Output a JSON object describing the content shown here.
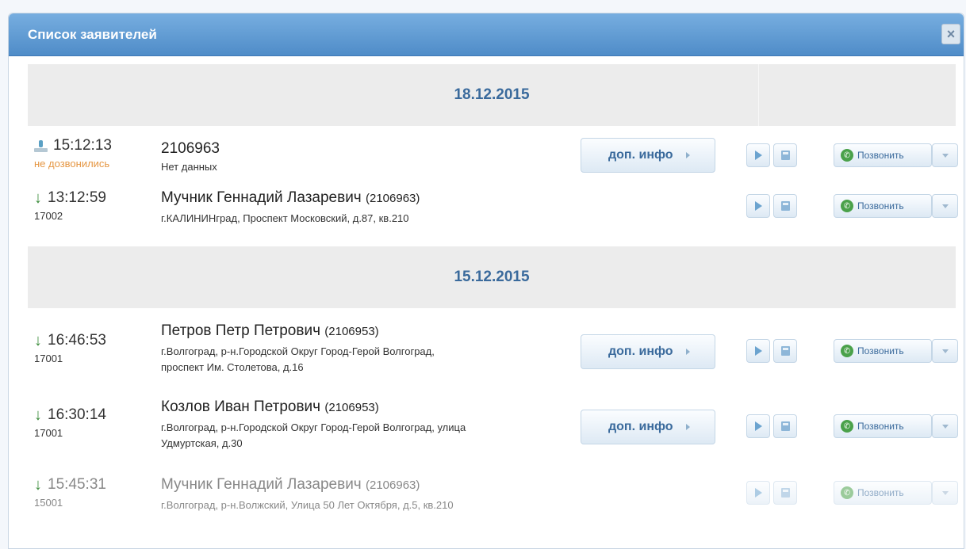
{
  "dialog": {
    "title": "Список заявителей",
    "close_icon": "close-icon"
  },
  "groups": [
    {
      "date": "18.12.2015",
      "rows": [
        {
          "time": "15:12:13",
          "sub": "не дозвонились",
          "icon": "phone-handset-icon",
          "name": "2106963",
          "code": "",
          "addr": [
            "Нет данных"
          ],
          "has_info": true
        },
        {
          "time": "13:12:59",
          "sub": "17002",
          "icon": "arrow-down-icon",
          "name": "Мучник Геннадий Лазаревич",
          "code": "(2106963)",
          "addr": [
            "г.КАЛИНИНград, Проспект Московский, д.87, кв.210"
          ],
          "has_info": false
        }
      ]
    },
    {
      "date": "15.12.2015",
      "rows": [
        {
          "time": "16:46:53",
          "sub": "17001",
          "icon": "arrow-down-icon",
          "name": "Петров Петр Петрович",
          "code": "(2106953)",
          "addr": [
            "г.Волгоград, р-н.Городской Округ Город-Герой Волгоград,",
            "проспект Им. Столетова, д.16"
          ],
          "has_info": true
        },
        {
          "time": "16:30:14",
          "sub": "17001",
          "icon": "arrow-down-icon",
          "name": "Козлов Иван Петрович",
          "code": "(2106953)",
          "addr": [
            "г.Волгоград, р-н.Городской Округ Город-Герой Волгоград, улица",
            "Удмуртская, д.30"
          ],
          "has_info": true
        },
        {
          "time": "15:45:31",
          "sub": "15001",
          "icon": "arrow-down-icon",
          "name": "Мучник Геннадий Лазаревич",
          "code": "(2106963)",
          "addr": [
            "г.Волгоград, р-н.Волжский, Улица 50 Лет Октября, д.5, кв.210"
          ],
          "has_info": false
        }
      ]
    }
  ],
  "buttons": {
    "info_label": "доп. инфо",
    "call_label": "Позвонить"
  },
  "colors": {
    "accent": "#4f8cc8",
    "date": "#3a6a9c",
    "fail": "#e59642",
    "arrow": "#3c8c3c"
  }
}
